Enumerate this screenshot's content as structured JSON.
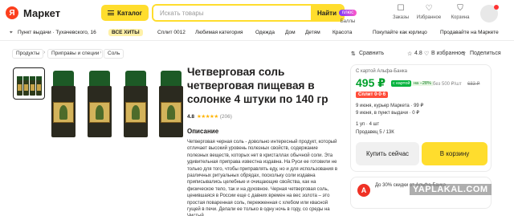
{
  "header": {
    "logo_text": "Маркет",
    "logo_letter": "Я",
    "catalog_label": "Каталог",
    "search_placeholder": "Искать товары",
    "search_button": "Найти",
    "icons": [
      {
        "name": "plus-icon",
        "badge": "плюс",
        "label": "Баллы"
      },
      {
        "name": "orders-icon",
        "glyph": "☐",
        "label": "Заказы"
      },
      {
        "name": "favorites-icon",
        "glyph": "♡",
        "label": "Избранное"
      },
      {
        "name": "cart-icon",
        "glyph": "⛉",
        "label": "Корзина"
      }
    ]
  },
  "subnav": {
    "pickup": "Пункт выдачи · Тухачевского, 16",
    "hits": "ВСЕ ХИТЫ",
    "links": [
      "Сплит 0012",
      "Любимая категория",
      "Одежда",
      "Дом",
      "Детям",
      "Красота"
    ],
    "right_links": [
      "Покупайте как юрлицо",
      "Продавайте на Маркете"
    ]
  },
  "breadcrumbs": [
    "Продукты",
    "Приправы и специи",
    "Соль"
  ],
  "actions": {
    "compare": "Сравнить",
    "rating": "4.8",
    "favorite": "В избранное",
    "share": "Поделиться"
  },
  "product": {
    "title": "Четверговая соль четверговая пищевая в солонке 4 штуки по 140 гр",
    "rating": "4.8",
    "stars": "★★★★★",
    "reviews": "(206)",
    "description_heading": "Описание",
    "description": "Четверговая черная соль - довольно интересный продукт, который отличает высокий уровень полезных свойств, содержание полезных веществ, которых нет в кристаллах обычной соли. Эта удивительная приправа известна издавна. На Руси ее готовили не только для того, чтобы приправлять еду, но и для использования в различных ритуальных обрядах, поскольку соли издавна приписывались целебные и очищающие свойства, как на физическое тело, так и на духовное. Черная четверговая соль, ценившаяся в России еще с давних времен на вес золота – это простая поваренная соль, пережженная с хлебом или квасной гущей в печи. Делали ее только в одну ночь в году, со среды на Чистый"
  },
  "buybox": {
    "card_note": "С картой Альфа-Банка",
    "price": "495 ₽",
    "price_card_badge": "с картой",
    "discount": "на −28%",
    "price_no_card": "без 500 ₽/шт",
    "old_price": "683 ₽",
    "split_tag": "Сплит 0·0·6",
    "delivery_courier": "9 июня, курьер Маркета · 99 ₽",
    "delivery_pickup": "9 июня, в пункт выдачи · 0 ₽",
    "packing": "1 уп · 4 шт",
    "seller": "Продавец 5 / 13К",
    "buy_now": "Купить сейчас",
    "add_to_cart": "В корзину"
  },
  "promo": {
    "bank_letter": "А",
    "text": "До 30% скидки от Альфа-Банка",
    "watermark": "YAPLAKAL.COM"
  },
  "colors": {
    "brand_yellow": "#ffdd2d",
    "price_green": "#00a02b",
    "logo_red": "#fc3f1d"
  }
}
